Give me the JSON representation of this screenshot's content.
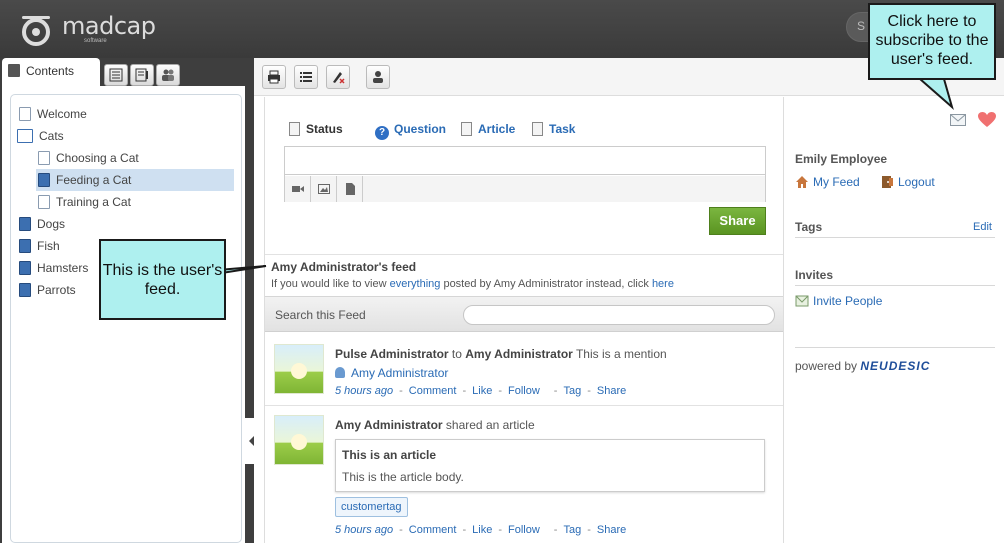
{
  "brand": {
    "name": "madcap",
    "sub": "software"
  },
  "top_search": {
    "placeholder": "S"
  },
  "left": {
    "tabs": {
      "contents_label": "Contents"
    },
    "toc": [
      {
        "label": "Welcome",
        "type": "page"
      },
      {
        "label": "Cats",
        "type": "openbook"
      },
      {
        "label": "Choosing a Cat",
        "type": "page"
      },
      {
        "label": "Feeding a Cat",
        "type": "book",
        "selected": true
      },
      {
        "label": "Training a Cat",
        "type": "page"
      },
      {
        "label": "Dogs",
        "type": "book"
      },
      {
        "label": "Fish",
        "type": "book"
      },
      {
        "label": "Hamsters",
        "type": "book"
      },
      {
        "label": "Parrots",
        "type": "book"
      }
    ]
  },
  "composer": {
    "tabs": {
      "status": "Status",
      "question": "Question",
      "article": "Article",
      "task": "Task"
    },
    "share_label": "Share"
  },
  "feed": {
    "title": "Amy Administrator's feed",
    "note_prefix": "If you would like to view ",
    "note_link": "everything",
    "note_middle": " posted by Amy Administrator instead, click ",
    "note_link2": "here",
    "search_label": "Search this Feed"
  },
  "posts": [
    {
      "author": "Pulse Administrator",
      "connector": " to ",
      "target": "Amy Administrator",
      "text": " This is a mention",
      "mention": "Amy Administrator",
      "ago": "5 hours ago",
      "actions": {
        "comment": "Comment",
        "like": "Like",
        "follow": "Follow",
        "tag": "Tag",
        "share": "Share"
      }
    },
    {
      "author": "Amy Administrator",
      "text": " shared an article",
      "article_title": "This is an article",
      "article_body": "This is the article body.",
      "tag": "customertag",
      "ago": "5 hours ago",
      "actions": {
        "comment": "Comment",
        "like": "Like",
        "follow": "Follow",
        "tag": "Tag",
        "share": "Share"
      }
    }
  ],
  "side": {
    "user": "Emily Employee",
    "my_feed": "My Feed",
    "logout": "Logout",
    "tags_head": "Tags",
    "edit": "Edit",
    "invites_head": "Invites",
    "invite_people": "Invite People",
    "powered_prefix": "powered by ",
    "powered_brand": "NEUDESIC"
  },
  "callouts": {
    "subscribe": "Click here to subscribe to the user's feed.",
    "feed": "This is the user's feed."
  },
  "colors": {
    "accent_link": "#2a6bb5",
    "share_green": "#6aa62f",
    "callout_bg": "#aef0ef",
    "selected_row": "#cfe0f1"
  }
}
